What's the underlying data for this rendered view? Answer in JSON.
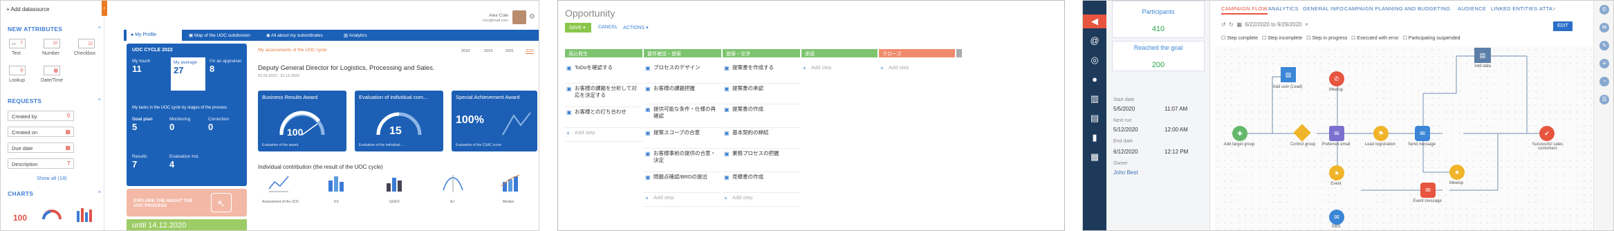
{
  "panel1": {
    "add_datasource": "Add datasource",
    "new_attributes": {
      "title": "NEW ATTRIBUTES",
      "items": [
        "Text",
        "Number",
        "Checkbox",
        "Lookup",
        "Date/Time"
      ]
    },
    "requests": {
      "title": "REQUESTS",
      "fields": [
        "Created by",
        "Created on",
        "Due date",
        "Description"
      ],
      "show_all": "Show all (18)"
    },
    "charts": {
      "title": "CHARTS",
      "sample_value": "100"
    },
    "user": {
      "name": "Alex Cole",
      "email": "cole@mail.com"
    },
    "tabs": [
      "My Profile",
      "Map of the UOC subdivision",
      "All about my subordinates",
      "Analytics"
    ],
    "uoc": {
      "title": "UOC CYCLE 2022",
      "top_tiles": [
        {
          "label": "My touch",
          "value": "11"
        },
        {
          "label": "My average",
          "value": "27"
        },
        {
          "label": "I'm an appraiser",
          "value": "8"
        }
      ],
      "sales_title": "My tasks in the UOC cycle by stages of the process",
      "stage_tiles": [
        {
          "label": "Goal plan",
          "value": "5"
        },
        {
          "label": "Monitoring",
          "value": "0"
        },
        {
          "label": "Correction",
          "value": "0"
        },
        {
          "label": "Results",
          "value": "7"
        },
        {
          "label": "Evaluation Ind.",
          "value": "4"
        }
      ],
      "explore": "EXPLORE THE ABOUT THE UOC PROCESS",
      "date_banner": "until 14.12.2020"
    },
    "assessments": {
      "title": "My assessments of the UOC cycle",
      "years": [
        "2018",
        "2019",
        "2021",
        "2022"
      ],
      "role": "Deputy General Director for Logistics, Processing and Sales.",
      "period": "01.01.2022 - 31.12.2022",
      "awards": [
        {
          "title": "Business Results Award",
          "value": "100"
        },
        {
          "title": "Evaluation of individual com...",
          "value": "15"
        },
        {
          "title": "Special Achievement Award",
          "value": "100%"
        }
      ],
      "award_notes": [
        "Evaluation of the award",
        "Evaluation of the individual ...",
        "Evaluation of the CSAC  score"
      ],
      "contrib_title": "Individual contribution (the result of the UOC cycle)",
      "contrib_labels": [
        "Assessment of the UOC",
        "KS",
        "QUEO",
        "AJ",
        "Median"
      ]
    }
  },
  "panel2": {
    "title": "Opportunity",
    "save": "SAVE",
    "cancel": "CANCEL",
    "actions": "ACTIONS",
    "stages": [
      "見込発生",
      "要件確認・提案",
      "提案・交渉",
      "承認",
      "クローズ"
    ],
    "columns": [
      [
        "ToDoを確認する",
        "お客様の課題を分析して対応を決定する",
        "お客様との打ち合わせ"
      ],
      [
        "プロセスのデザイン",
        "お客様の課題把握",
        "提供可能な条件・仕様の再確認",
        "提案スコープの合意",
        "お客様事前の提供の合意・決定",
        "問題点確認/BRDの提出"
      ],
      [
        "提案書を作成する",
        "提案書の承認",
        "提案書の作成",
        "基本契約の締結",
        "業務プロセスの把握",
        "見積書の作成"
      ]
    ],
    "add_step": "Add step"
  },
  "panel3": {
    "participants": {
      "label": "Participants",
      "value": "410"
    },
    "reached": {
      "label": "Reached the goal",
      "value": "200"
    },
    "rows": [
      {
        "label": "Start date",
        "date": "5/5/2020",
        "time": "11:07 AM"
      },
      {
        "label": "Next run",
        "date": "5/12/2020",
        "time": "12:00 AM"
      },
      {
        "label": "End date",
        "date": "6/12/2020",
        "time": "12:12 PM"
      }
    ],
    "owner_label": "Owner",
    "owner": "John Best",
    "tabs": [
      "CAMPAIGN FLOW",
      "ANALYTICS",
      "GENERAL INFO",
      "CAMPAIGN PLANNING AND BUDGETING",
      "AUDIENCE",
      "LINKED ENTITIES",
      "ATTA"
    ],
    "date_range": "6/22/2020 to 9/29/2020",
    "edit": "EDIT",
    "filters": [
      "Step complete",
      "Step incomplete",
      "Step in progress",
      "Executed with error",
      "Participating suspended"
    ],
    "nodes": [
      "Add target group",
      "Add user (Lead)",
      "Control group",
      "Preferred email",
      "Meetup",
      "Lead registration",
      "Event",
      "Meetup",
      "SMS",
      "Send message",
      "Event message",
      "Add data",
      "Successful sales customers"
    ],
    "colors": {
      "blue": "#3b86d6",
      "green": "#64b86a",
      "yellow": "#f0b429",
      "red": "#e8553f",
      "purple": "#7b6fcf"
    }
  }
}
